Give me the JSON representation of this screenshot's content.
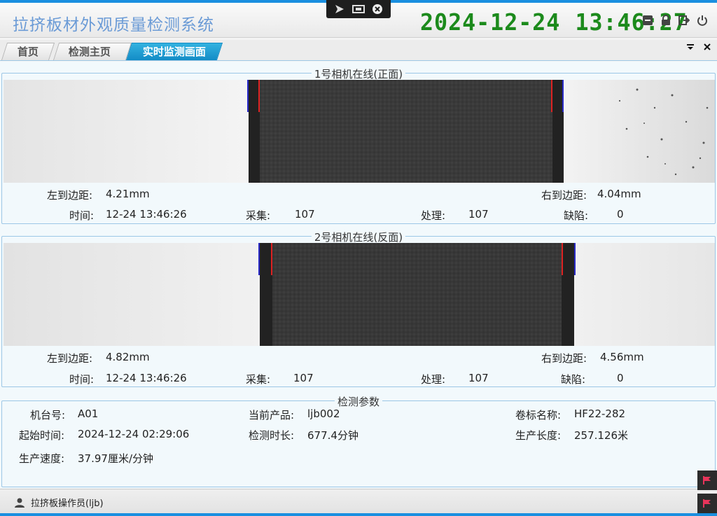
{
  "app": {
    "title": "拉挤板材外观质量检测系统",
    "clock_date": "2024-12-24",
    "clock_time": "13:46:27"
  },
  "tabs": [
    {
      "label": "首页"
    },
    {
      "label": "检测主页面"
    },
    {
      "label": "实时监测画面"
    }
  ],
  "camera1": {
    "title": "1号相机在线(正面)",
    "left_label": "左到边距:",
    "left_value": "4.21mm",
    "right_label": "右到边距:",
    "right_value": "4.04mm",
    "time_label": "时间:",
    "time_value": "12-24 13:46:26",
    "collect_label": "采集:",
    "collect_value": "107",
    "process_label": "处理:",
    "process_value": "107",
    "defect_label": "缺陷:",
    "defect_value": "0"
  },
  "camera2": {
    "title": "2号相机在线(反面)",
    "left_label": "左到边距:",
    "left_value": "4.82mm",
    "right_label": "右到边距:",
    "right_value": "4.56mm",
    "time_label": "时间:",
    "time_value": "12-24 13:46:26",
    "collect_label": "采集:",
    "collect_value": "107",
    "process_label": "处理:",
    "process_value": "107",
    "defect_label": "缺陷:",
    "defect_value": "0"
  },
  "params": {
    "title": "检测参数",
    "machine_label": "机台号:",
    "machine_value": "A01",
    "product_label": "当前产品:",
    "product_value": "ljb002",
    "roll_label": "卷标名称:",
    "roll_value": "HF22-282",
    "start_label": "起始时间:",
    "start_value": "2024-12-24 02:29:06",
    "duration_label": "检测时长:",
    "duration_value": "677.4分钟",
    "length_label": "生产长度:",
    "length_value": "257.126米",
    "speed_label": "生产速度:",
    "speed_value": "37.97厘米/分钟"
  },
  "status": {
    "user": "拉挤板操作员(ljb)"
  },
  "colors": {
    "accent": "#1a8fe0",
    "active_tab": "#1f9fd6",
    "clock": "#1c8a1c",
    "title": "#6b9bd6"
  },
  "icons": {
    "toolbar": [
      "cursor-icon",
      "screen-icon",
      "close-circle-icon"
    ],
    "window": [
      "minimize-icon",
      "lock-icon",
      "logout-icon",
      "power-icon"
    ],
    "side": [
      "flag-icon",
      "flag-icon"
    ]
  }
}
